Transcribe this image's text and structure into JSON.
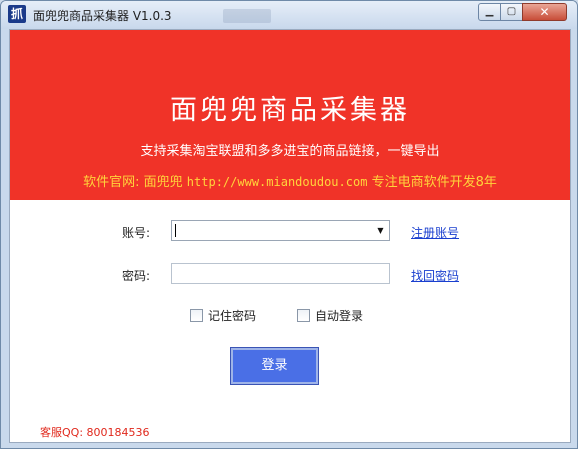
{
  "window": {
    "title": "面兜兜商品采集器 V1.0.3",
    "icon_char": "抓",
    "icon": "app-logo-icon"
  },
  "window_controls": {
    "minimize_icon": "minimize-icon",
    "maximize_icon": "maximize-icon",
    "close_icon": "close-icon"
  },
  "banner": {
    "title": "面兜兜商品采集器",
    "subtitle": "支持采集淘宝联盟和多多进宝的商品链接，一键导出",
    "site_prefix": "软件官网: 面兜兜",
    "site_url": "http://www.miandoudou.com",
    "site_suffix": "专注电商软件开发8年",
    "background_color": "#f03328",
    "highlight_color": "#ffd43b"
  },
  "form": {
    "account_label": "账号:",
    "account_value": "",
    "password_label": "密码:",
    "password_value": "",
    "register_link": "注册账号",
    "recover_link": "找回密码",
    "remember_label": "记住密码",
    "remember_checked": false,
    "autologin_label": "自动登录",
    "autologin_checked": false,
    "login_button": "登录",
    "login_button_color": "#4a6fe6"
  },
  "footer": {
    "qq_support": "客服QQ: 800184536"
  }
}
